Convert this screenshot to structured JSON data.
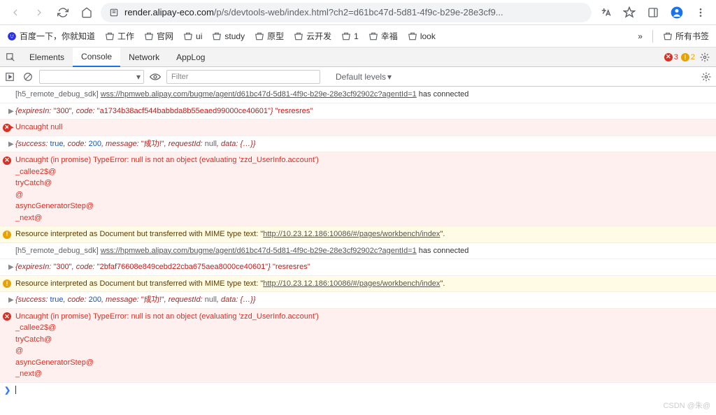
{
  "url": {
    "domain": "render.alipay-eco.com",
    "path": "/p/s/devtools-web/index.html?ch2=d61bc47d-5d81-4f9c-b29e-28e3cf9..."
  },
  "bookmarks": {
    "first": "百度一下，你就知道",
    "items": [
      "工作",
      "官网",
      "ui",
      "study",
      "原型",
      "云开发",
      "1",
      "幸福",
      "look"
    ],
    "all": "所有书签"
  },
  "devtabs": [
    "Elements",
    "Console",
    "Network",
    "AppLog"
  ],
  "devtabs_active": 1,
  "status": {
    "errors": "3",
    "warnings": "2"
  },
  "console_toolbar": {
    "filter_placeholder": "Filter",
    "levels": "Default levels"
  },
  "log1": {
    "tag": "[h5_remote_debug_sdk]",
    "url": "wss://hpmweb.alipay.com/bugme/agent/d61bc47d-5d81-4f9c-b29e-28e3cf92902c?agentId=1",
    "suffix": " has connected"
  },
  "log2": {
    "pre": "{expiresIn: ",
    "v1": "\"300\"",
    "mid": ", code: ",
    "v2": "\"a1734b38acf544babbda8b55eaed99000ce40601\"",
    "post": "}",
    "extra": " \"resresres\""
  },
  "log3": "Uncaught null",
  "log4": {
    "pre": "{success: ",
    "v1": "true",
    "a": ", code: ",
    "v2": "200",
    "b": ", message: ",
    "v3": "\"成功!\"",
    "c": ", requestId: ",
    "v4": "null",
    "d": ", data: ",
    "v5": "{…}",
    "post": "}"
  },
  "log5": {
    "l1": "Uncaught (in promise) TypeError: null is not an object (evaluating 'zzd_UserInfo.account')",
    "l2": "_callee2$@",
    "l3": "tryCatch@",
    "l4": "@",
    "l5": "asyncGeneratorStep@",
    "l6": "_next@"
  },
  "log6": {
    "pre": "Resource interpreted as Document but transferred with MIME type text: \"",
    "url": "http://10.23.12.186:10086/#/pages/workbench/index",
    "post": "\"."
  },
  "log7": {
    "pre": "{expiresIn: ",
    "v1": "\"300\"",
    "mid": ", code: ",
    "v2": "\"2bfaf76608e849cebd22cba675aea8000ce40601\"",
    "post": "}",
    "extra": " \"resresres\""
  },
  "watermark": "CSDN @朱@"
}
